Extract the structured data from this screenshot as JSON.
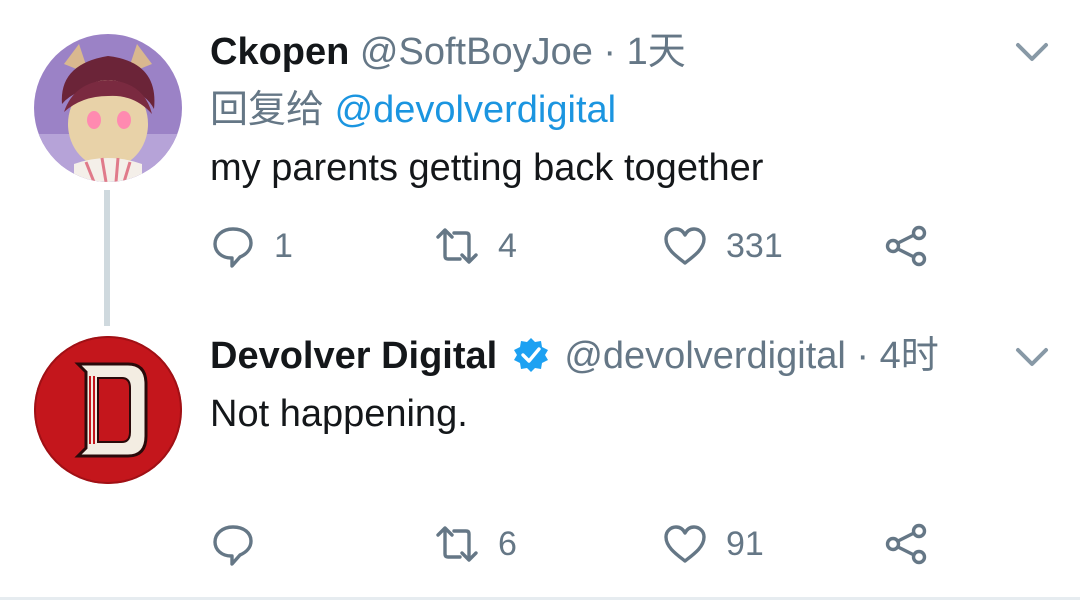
{
  "tweets": [
    {
      "name": "Ckopen",
      "handle": "@SoftBoyJoe",
      "separator": "·",
      "time": "1天",
      "reply_prefix": "回复给",
      "reply_mention": "@devolverdigital",
      "text": "my parents getting back together",
      "replies": "1",
      "retweets": "4",
      "likes": "331"
    },
    {
      "name": "Devolver Digital",
      "verified": true,
      "handle": "@devolverdigital",
      "separator": "·",
      "time": "4时",
      "text": "Not happening.",
      "replies": "",
      "retweets": "6",
      "likes": "91"
    }
  ],
  "colors": {
    "accent": "#1b95e0",
    "muted": "#657786",
    "avatar_red": "#c4161c"
  },
  "icons": [
    "reply-icon",
    "retweet-icon",
    "like-icon",
    "share-icon",
    "chevron-down-icon",
    "verified-badge-icon"
  ]
}
